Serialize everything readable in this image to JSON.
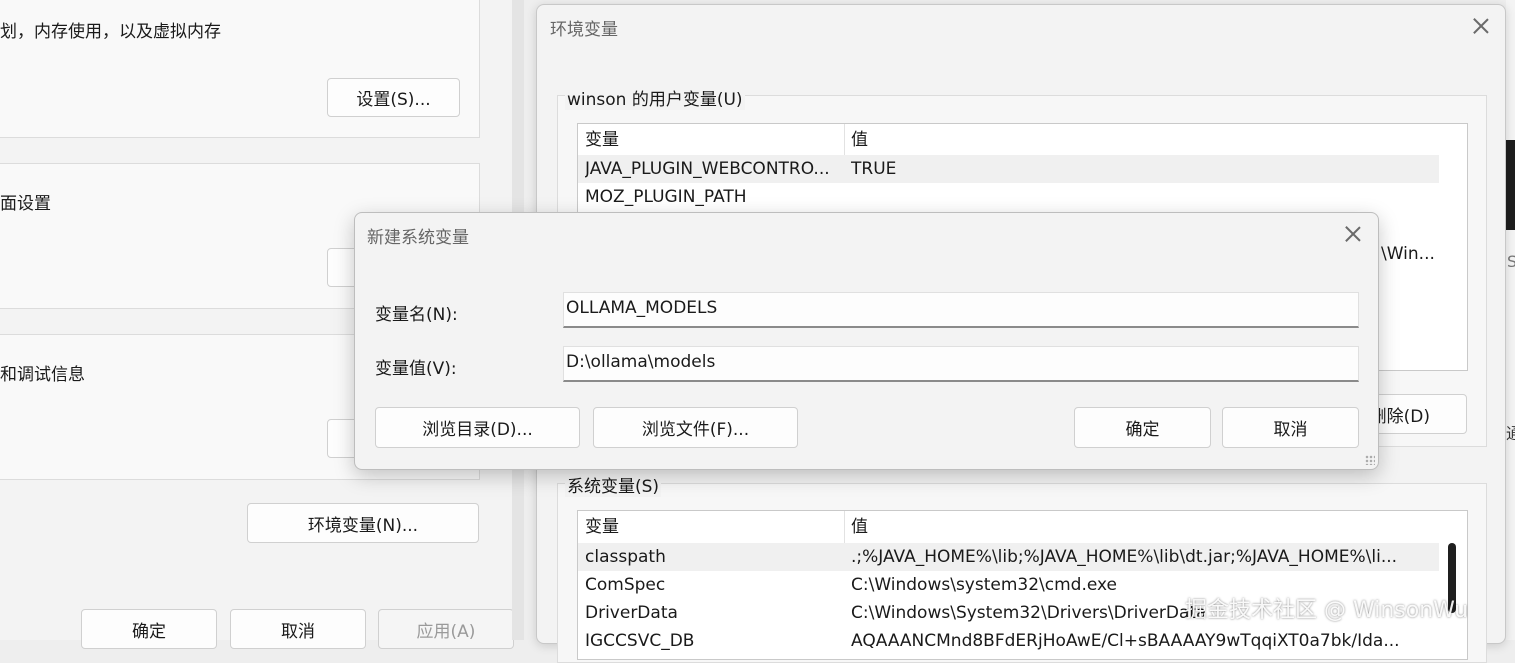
{
  "sysprops": {
    "perf_text": "划，内存使用，以及虚拟内存",
    "perf_settings": "设置(S)...",
    "profile_text": "面设置",
    "startup_text": "和调试信息",
    "env_button": "环境变量(N)...",
    "ok": "确定",
    "cancel": "取消",
    "apply": "应用(A)"
  },
  "env": {
    "title": "环境变量",
    "user_group": "winson 的用户变量(U)",
    "system_group": "系统变量(S)",
    "col_var": "变量",
    "col_val": "值",
    "user_rows": [
      {
        "name": "JAVA_PLUGIN_WEBCONTRO...",
        "value": "TRUE"
      },
      {
        "name": "MOZ_PLUGIN_PATH",
        "value": ""
      }
    ],
    "user_partial_value": "\\Win...",
    "delete_partial": "删除(D)",
    "system_rows": [
      {
        "name": "classpath",
        "value": ".;%JAVA_HOME%\\lib;%JAVA_HOME%\\lib\\dt.jar;%JAVA_HOME%\\li..."
      },
      {
        "name": "ComSpec",
        "value": "C:\\Windows\\system32\\cmd.exe"
      },
      {
        "name": "DriverData",
        "value": "C:\\Windows\\System32\\Drivers\\DriverData"
      },
      {
        "name": "IGCCSVC_DB",
        "value": "AQAAANCMnd8BFdERjHoAwE/Cl+sBAAAAY9wTqqiXT0a7bk/Ida..."
      }
    ]
  },
  "new_var": {
    "title": "新建系统变量",
    "name_label": "变量名(N):",
    "name_value": "OLLAMA_MODELS",
    "value_label": "变量值(V):",
    "value_value": "D:\\ollama\\models",
    "browse_dir": "浏览目录(D)...",
    "browse_file": "浏览文件(F)...",
    "ok": "确定",
    "cancel": "取消"
  },
  "watermark": "掘金技术社区 @ WinsonWu",
  "right_edge_glyphs": [
    "S",
    "通"
  ]
}
